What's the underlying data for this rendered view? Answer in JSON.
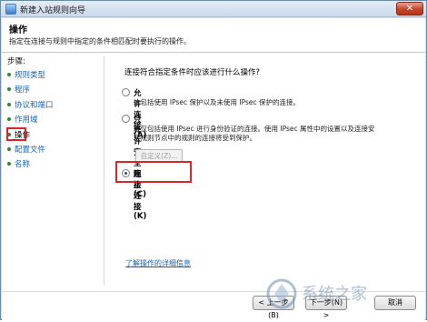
{
  "window": {
    "title": "新建入站规则向导",
    "close_label": "✕"
  },
  "header": {
    "title": "操作",
    "description": "指定在连接与规则中指定的条件相匹配时要执行的操作。"
  },
  "sidebar": {
    "steps_label": "步骤:",
    "items": [
      {
        "label": "规则类型"
      },
      {
        "label": "程序"
      },
      {
        "label": "协议和端口"
      },
      {
        "label": "作用域"
      },
      {
        "label": "操作",
        "current": true
      },
      {
        "label": "配置文件"
      },
      {
        "label": "名称"
      }
    ]
  },
  "main": {
    "question": "连接符合指定条件时应该进行什么操作?",
    "options": [
      {
        "title": "允许连接(A)",
        "desc": "这包括使用 IPsec 保护以及未使用 IPsec 保护的连接。",
        "checked": false
      },
      {
        "title": "只允许安全连接(C)",
        "desc1": "这仅包括使用 IPsec 进行身份验证的连接。使用 IPsec 属性中的设置以及连接安",
        "desc2": "全规则节点中的规则的连接将受到保护。",
        "checked": false
      },
      {
        "title": "阻止连接(K)",
        "checked": true
      }
    ],
    "custom_button": "自定义(Z)...",
    "learn_more_link": "了解操作的详细信息"
  },
  "footer": {
    "back_button": "< 上一步(B)",
    "next_button": "下一步(N) >",
    "cancel_button": "取消"
  },
  "watermark_text": "系统之家",
  "colors": {
    "accent_link": "#1464b4",
    "highlight_red": "#d9262c"
  }
}
